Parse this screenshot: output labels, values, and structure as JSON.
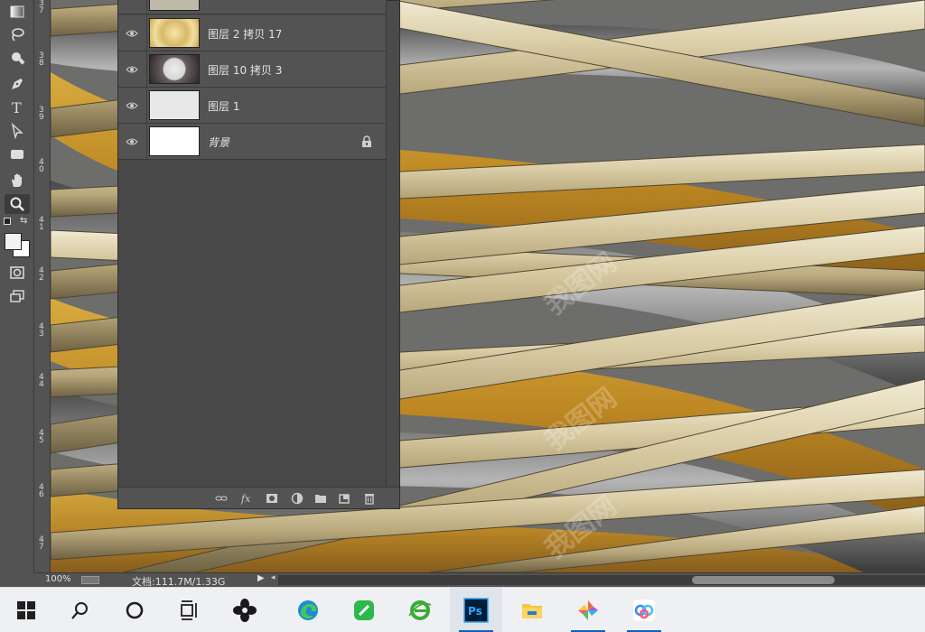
{
  "layers": [
    {
      "name": "图层 2 拷贝 17",
      "thumb": "gold-burst"
    },
    {
      "name": "图层 10 拷贝 3",
      "thumb": "circle-transparent"
    },
    {
      "name": "图层 1",
      "thumb": "light-gray"
    },
    {
      "name": "背景",
      "thumb": "white",
      "locked": true
    }
  ],
  "ruler_labels": [
    "3\n7",
    "3\n8",
    "3\n9",
    "4\n0",
    "4\n1",
    "4\n2",
    "4\n3",
    "4\n4",
    "4\n5",
    "4\n6",
    "4\n7"
  ],
  "status": {
    "zoom": "100%",
    "doc_info": "文档:111.7M/1.33G"
  },
  "watermark_text": "我图网",
  "panel_buttons": [
    "link-icon",
    "fx-icon",
    "mask-icon",
    "adjustment-icon",
    "folder-icon",
    "new-layer-icon",
    "trash-icon"
  ],
  "tools": [
    "gradient-tool-icon",
    "lasso-tool-icon",
    "smudge-tool-icon",
    "pen-tool-icon",
    "type-tool-icon",
    "path-selection-tool-icon",
    "rectangle-tool-icon",
    "hand-tool-icon",
    "zoom-tool-icon",
    "quick-mask-icon",
    "screen-mode-icon"
  ],
  "taskbar": [
    "windows-start-icon",
    "search-icon",
    "cortana-icon",
    "task-view-icon",
    "pinwheel-app-icon",
    "edge-icon",
    "green-app-icon",
    "ie-browser-icon",
    "photoshop-icon",
    "file-explorer-icon",
    "color-app-icon",
    "baidu-netdisk-icon"
  ],
  "colors": {
    "ps_blue": "#31a8ff",
    "panel_bg": "#494949",
    "accent": "#0a63c4"
  }
}
